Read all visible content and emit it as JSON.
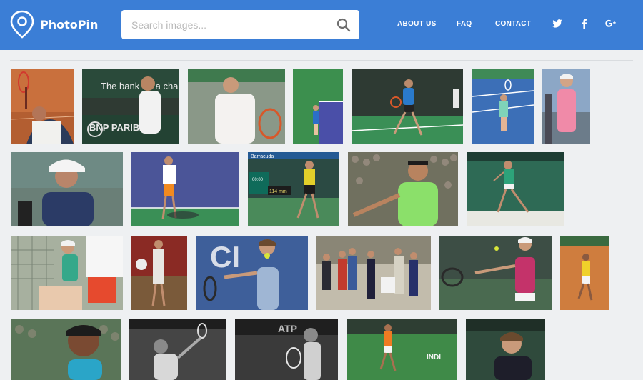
{
  "header": {
    "logo_text": "PhotoPin",
    "search_placeholder": "Search images...",
    "nav": [
      "ABOUT US",
      "FAQ",
      "CONTACT"
    ],
    "social_icons": [
      "twitter-icon",
      "facebook-icon",
      "google-plus-icon"
    ],
    "brand_color": "#3b7ed6"
  },
  "gallery": {
    "rows": [
      {
        "label": "row-1",
        "tiles": [
          {
            "bg": "#c86b3a"
          },
          {
            "bg": "#2f3a33",
            "caption": "The bank for a chan",
            "caption2": "BNP PARIBAS"
          },
          {
            "bg": "#7c8a7d"
          },
          {
            "bg": "#3c8f4e"
          },
          {
            "bg": "#2b6a45"
          },
          {
            "bg": "#3b74b8"
          },
          {
            "bg": "#8ca7c6"
          }
        ]
      },
      {
        "label": "row-2",
        "tiles": [
          {
            "bg": "#6a7f77"
          },
          {
            "bg": "#4a5ca0"
          },
          {
            "bg": "#2e5e4f",
            "caption": "Barracuda",
            "caption2": "114 mm"
          },
          {
            "bg": "#6b6a5e"
          },
          {
            "bg": "#2c5a4a"
          }
        ]
      },
      {
        "label": "row-3",
        "tiles": [
          {
            "bg": "#8c9a86"
          },
          {
            "bg": "#7b2a24"
          },
          {
            "bg": "#3d5a8e",
            "caption": "CI"
          },
          {
            "bg": "#b9b4a4"
          },
          {
            "bg": "#3b4c43"
          },
          {
            "bg": "#c97a3a"
          }
        ]
      },
      {
        "label": "row-4",
        "tiles": [
          {
            "bg": "#4a6a4a"
          },
          {
            "bg": "#3a3a3a"
          },
          {
            "bg": "#2e2e2e"
          },
          {
            "bg": "#3e7b42",
            "caption": "INDI"
          },
          {
            "bg": "#2c4a3a"
          }
        ]
      }
    ]
  }
}
